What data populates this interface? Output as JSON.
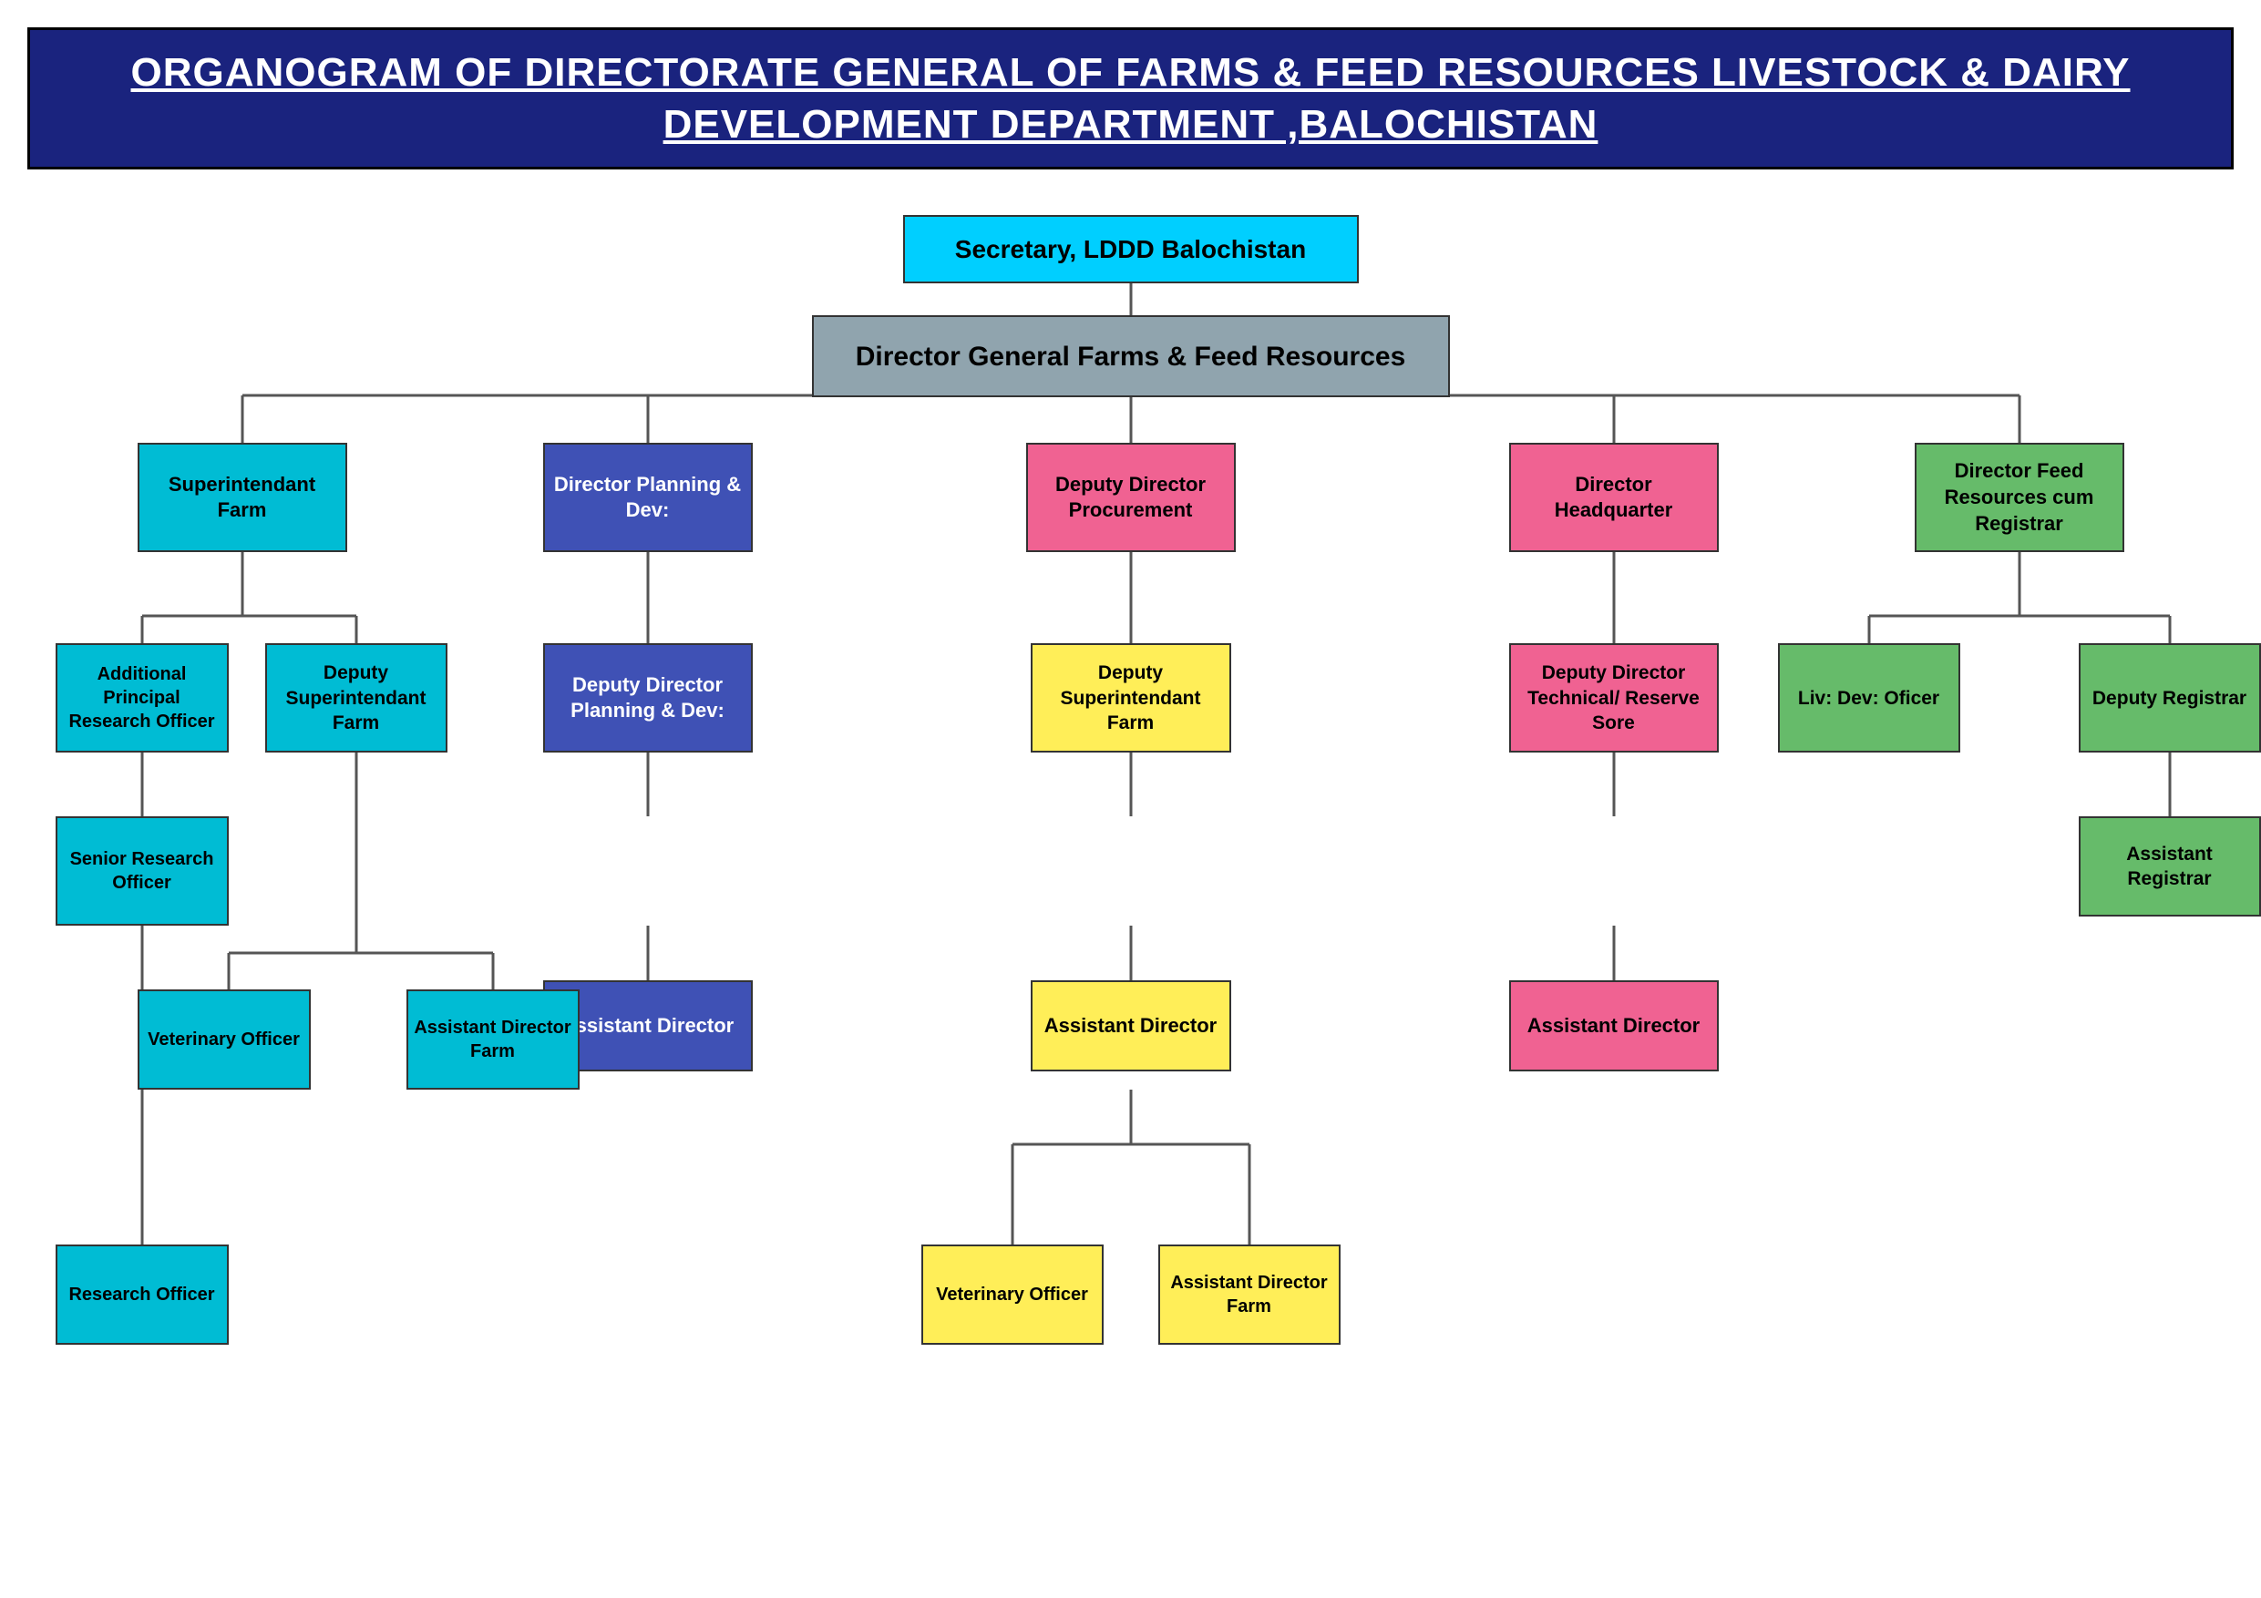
{
  "title": {
    "line1": "ORGANOGRAM OF DIRECTORATE GENERAL OF FARMS & FEED RESOURCES LIVESTOCK & DAIRY",
    "line2": "DEVELOPMENT DEPARTMENT ,BALOCHISTAN"
  },
  "nodes": {
    "secretary": "Secretary, LDDD Balochistan",
    "dg": "Director General Farms & Feed Resources",
    "superintendent_farm": "Superintendant Farm",
    "director_planning": "Director Planning & Dev:",
    "deputy_director_procurement": "Deputy Director Procurement",
    "director_headquarter": "Director Headquarter",
    "director_feed": "Director Feed Resources cum Registrar",
    "additional_principal": "Additional Principal Research Officer",
    "deputy_superintendent": "Deputy  Superintendant Farm",
    "deputy_director_planning": "Deputy Director Planning & Dev:",
    "deputy_superintendent_farm2": "Deputy Superintendant Farm",
    "deputy_director_technical": "Deputy  Director Technical/ Reserve Sore",
    "liv_dev_officer": "Liv: Dev: Oficer",
    "deputy_registrar": "Deputy Registrar",
    "senior_research_officer": "Senior Research Officer",
    "assistant_director_pd": "Assistant  Director",
    "assistant_director_hq": "Assistant  Director",
    "assistant_registrar": "Assistant Registrar",
    "veterinary_officer1": "Veterinary Officer",
    "assistant_director_farm1": "Assistant Director Farm",
    "research_officer": "Research Officer",
    "veterinary_officer2": "Veterinary Officer",
    "assistant_director_farm2": "Assistant  Director Farm"
  }
}
